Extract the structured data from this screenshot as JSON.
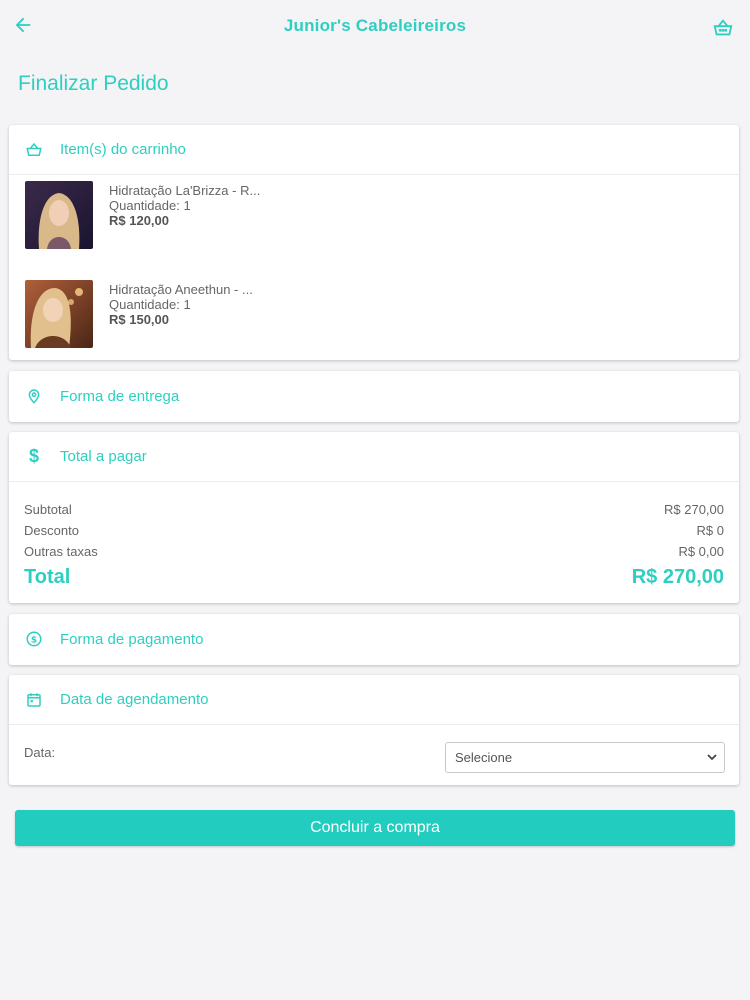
{
  "app": {
    "title": "Junior's Cabeleireiros",
    "accent": "#2ecfc1"
  },
  "page": {
    "title": "Finalizar Pedido"
  },
  "icons": {
    "back": "arrow-left-icon",
    "cart": "basket-icon",
    "items": "basket-icon",
    "delivery": "map-pin-icon",
    "total": "dollar-icon",
    "payment": "dollar-circle-icon",
    "schedule": "calendar-icon"
  },
  "cart": {
    "header": "Item(s) do carrinho",
    "items": [
      {
        "name": "Hidratação La'Brizza - R...",
        "quantity": "Quantidade: 1",
        "price": "R$ 120,00"
      },
      {
        "name": "Hidratação Aneethun - ...",
        "quantity": "Quantidade: 1",
        "price": "R$ 150,00"
      }
    ]
  },
  "delivery": {
    "header": "Forma de entrega"
  },
  "totals": {
    "header": "Total a pagar",
    "subtotal_label": "Subtotal",
    "subtotal_value": "R$ 270,00",
    "discount_label": "Desconto",
    "discount_value": "R$ 0",
    "fees_label": "Outras taxas",
    "fees_value": "R$ 0,00",
    "total_label": "Total",
    "total_value": "R$ 270,00"
  },
  "payment": {
    "header": "Forma de pagamento"
  },
  "schedule": {
    "header": "Data de agendamento",
    "date_label": "Data:",
    "date_select": "Selecione"
  },
  "submit": {
    "label": "Concluir a compra"
  }
}
